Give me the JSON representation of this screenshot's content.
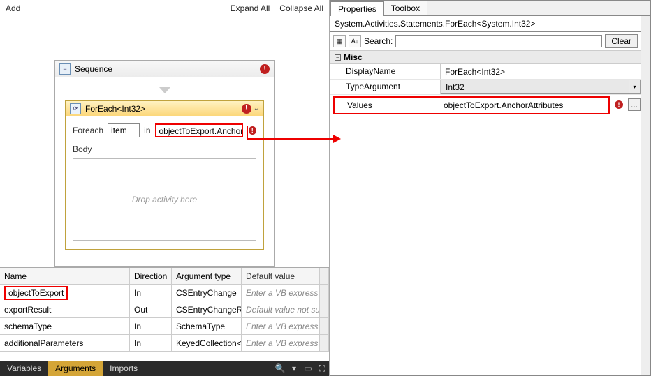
{
  "toolbar": {
    "add": "Add",
    "expand_all": "Expand All",
    "collapse_all": "Collapse All"
  },
  "sequence": {
    "title": "Sequence"
  },
  "foreach": {
    "title": "ForEach<Int32>",
    "foreach_label": "Foreach",
    "item": "item",
    "in_label": "in",
    "expression": "objectToExport.Anchor",
    "body_label": "Body",
    "drop_hint": "Drop activity here"
  },
  "args_header": {
    "name": "Name",
    "direction": "Direction",
    "type": "Argument type",
    "default": "Default value"
  },
  "args": [
    {
      "name": "objectToExport",
      "dir": "In",
      "type": "CSEntryChange",
      "def": "Enter a VB express"
    },
    {
      "name": "exportResult",
      "dir": "Out",
      "type": "CSEntryChangeRes",
      "def": "Default value not su"
    },
    {
      "name": "schemaType",
      "dir": "In",
      "type": "SchemaType",
      "def": "Enter a VB express"
    },
    {
      "name": "additionalParameters",
      "dir": "In",
      "type": "KeyedCollection<S",
      "def": "Enter a VB express"
    }
  ],
  "bottom": {
    "variables": "Variables",
    "arguments": "Arguments",
    "imports": "Imports"
  },
  "right": {
    "tab_properties": "Properties",
    "tab_toolbox": "Toolbox",
    "type_line": "System.Activities.Statements.ForEach<System.Int32>",
    "search_label": "Search:",
    "clear": "Clear",
    "misc": "Misc",
    "displayname_label": "DisplayName",
    "displayname_value": "ForEach<Int32>",
    "typearg_label": "TypeArgument",
    "typearg_value": "Int32",
    "values_label": "Values",
    "values_value": "objectToExport.AnchorAttributes",
    "ellipsis": "..."
  }
}
